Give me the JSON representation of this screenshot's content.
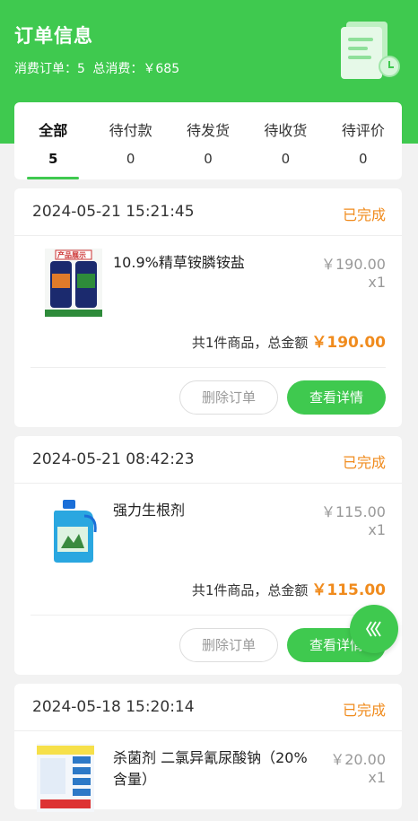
{
  "header": {
    "title": "订单信息",
    "orders_label": "消费订单：5",
    "total_label": "总消费：￥685"
  },
  "tabs": [
    {
      "label": "全部",
      "count": "5",
      "active": true
    },
    {
      "label": "待付款",
      "count": "0"
    },
    {
      "label": "待发货",
      "count": "0"
    },
    {
      "label": "待收货",
      "count": "0"
    },
    {
      "label": "待评价",
      "count": "0"
    }
  ],
  "orders": [
    {
      "date": "2024-05-21 15:21:45",
      "status": "已完成",
      "product": "10.9%精草铵膦铵盐",
      "price": "￥190.00",
      "qty": "x1",
      "total_text": "共1件商品，总金额",
      "total_amount": "￥190.00",
      "image_caption": "产品展示",
      "delete_label": "删除订单",
      "detail_label": "查看详情"
    },
    {
      "date": "2024-05-21 08:42:23",
      "status": "已完成",
      "product": "强力生根剂",
      "price": "￥115.00",
      "qty": "x1",
      "total_text": "共1件商品，总金额",
      "total_amount": "￥115.00",
      "delete_label": "删除订单",
      "detail_label": "查看详情"
    },
    {
      "date": "2024-05-18 15:20:14",
      "status": "已完成",
      "product": "杀菌剂 二氯异氰尿酸钠（20%含量）",
      "price": "￥20.00",
      "qty": "x1"
    }
  ],
  "colors": {
    "brand": "#3fc94f",
    "status": "#f08b1d"
  },
  "icons": {
    "header": "receipt-clock-icon",
    "float": "chevron-left-triple-icon"
  }
}
